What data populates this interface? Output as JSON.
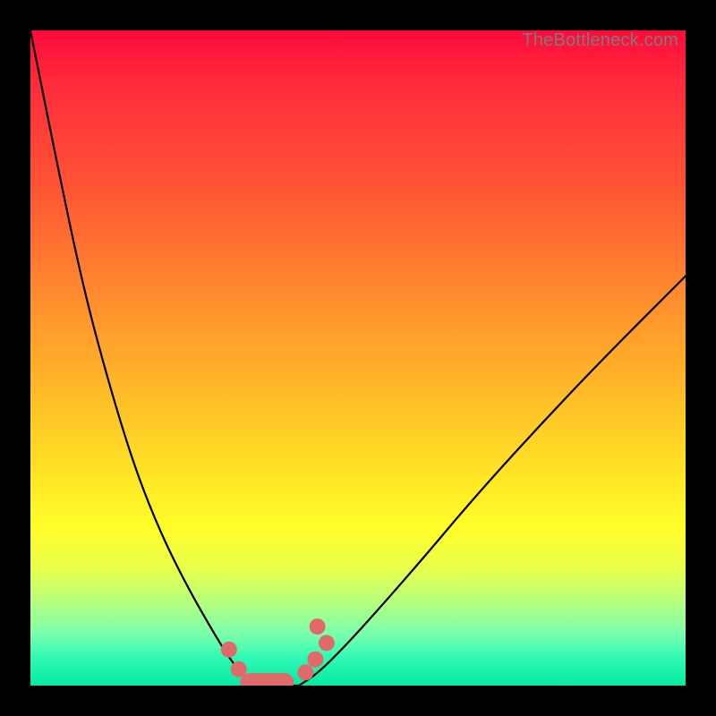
{
  "watermark": "TheBottleneck.com",
  "chart_data": {
    "type": "line",
    "title": "",
    "xlabel": "",
    "ylabel": "",
    "series": [
      {
        "name": "left-branch",
        "x": [
          0.0,
          0.04,
          0.08,
          0.12,
          0.16,
          0.2,
          0.24,
          0.28,
          0.305,
          0.325,
          0.34
        ],
        "y": [
          1.0,
          0.8,
          0.61,
          0.46,
          0.33,
          0.23,
          0.15,
          0.08,
          0.04,
          0.015,
          0.0
        ]
      },
      {
        "name": "bottom-flat",
        "x": [
          0.34,
          0.41
        ],
        "y": [
          0.0,
          0.0
        ]
      },
      {
        "name": "right-branch",
        "x": [
          0.41,
          0.44,
          0.48,
          0.53,
          0.6,
          0.68,
          0.78,
          0.88,
          1.0
        ],
        "y": [
          0.0,
          0.02,
          0.06,
          0.115,
          0.195,
          0.29,
          0.4,
          0.505,
          0.625
        ]
      }
    ],
    "markers_left": [
      {
        "x": 0.303,
        "y": 0.055
      },
      {
        "x": 0.318,
        "y": 0.025
      }
    ],
    "markers_right": [
      {
        "x": 0.42,
        "y": 0.02
      },
      {
        "x": 0.435,
        "y": 0.04
      },
      {
        "x": 0.452,
        "y": 0.065
      },
      {
        "x": 0.438,
        "y": 0.09
      }
    ],
    "bottom_bar": {
      "x0": 0.32,
      "x1": 0.402,
      "y": 0.005,
      "thickness": 0.028
    },
    "colors": {
      "gradient_top": "#ff0a3a",
      "gradient_mid": "#ffe225",
      "gradient_bottom": "#06e9a2",
      "curve": "#000000",
      "marker": "#e06a6a",
      "frame": "#000000"
    },
    "xlim": [
      0,
      1
    ],
    "ylim": [
      0,
      1
    ]
  }
}
